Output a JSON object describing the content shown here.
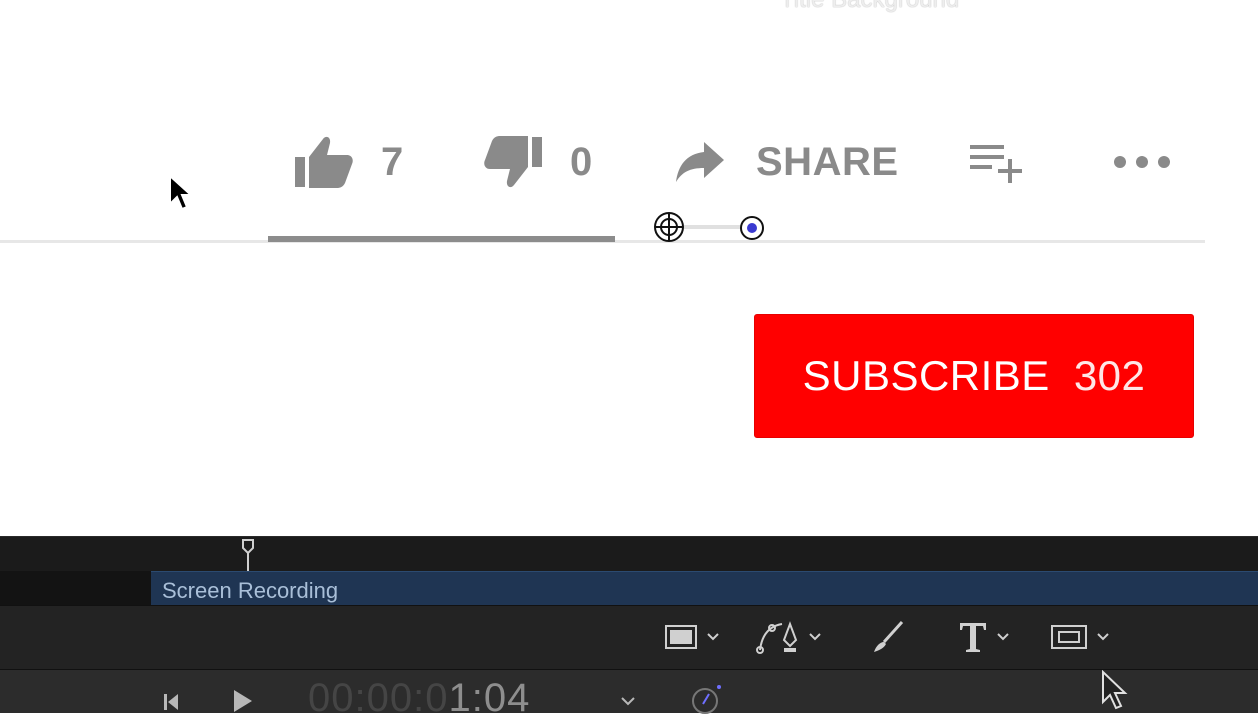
{
  "top_partial_text": "Title Background",
  "actions": {
    "like_count": "7",
    "dislike_count": "0",
    "share_label": "SHARE"
  },
  "subscribe": {
    "label": "SUBSCRIBE",
    "count": "302"
  },
  "timeline": {
    "clip_label": "Screen Recording"
  },
  "transport": {
    "timecode_dim": "00:00:0",
    "timecode_bright": "1:04"
  },
  "icons": {
    "like": "thumbs-up-icon",
    "dislike": "thumbs-down-icon",
    "share": "share-arrow-icon",
    "add_to_playlist": "playlist-add-icon",
    "more": "more-dots-icon",
    "rectangle_tool": "rectangle-icon",
    "pen_tool": "bezier-pen-icon",
    "brush_tool": "brush-icon",
    "text_tool": "text-icon",
    "frame_tool": "frame-icon",
    "playhead": "playhead-icon",
    "skip_back": "skip-back-icon",
    "play": "play-icon",
    "speed": "retime-icon"
  },
  "colors": {
    "subscribe_red": "#ff0000",
    "clip_blue": "#1f3553",
    "icon_gray": "#8a8a8a"
  }
}
